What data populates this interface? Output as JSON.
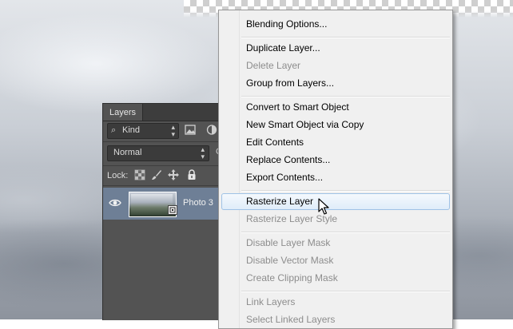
{
  "layers_panel": {
    "tab_label": "Layers",
    "filter": {
      "selected": "Kind",
      "icons": [
        "image-filter-icon",
        "adjustment-filter-icon"
      ]
    },
    "blend_mode": "Normal",
    "opacity_label_fragment": "O",
    "lock_label": "Lock:",
    "lock_icons": [
      "lock-transparent-pixels-icon",
      "lock-image-pixels-icon",
      "lock-position-icon",
      "lock-all-icon"
    ],
    "layers": [
      {
        "name": "Photo 3",
        "visible": true,
        "selected": true,
        "smart_object": true
      }
    ]
  },
  "context_menu": {
    "highlighted_item": "Rasterize Layer",
    "items": [
      {
        "label": "Blending Options...",
        "enabled": true
      },
      {
        "label": "Duplicate Layer...",
        "enabled": true
      },
      {
        "label": "Delete Layer",
        "enabled": false
      },
      {
        "label": "Group from Layers...",
        "enabled": true
      },
      {
        "label": "Convert to Smart Object",
        "enabled": true
      },
      {
        "label": "New Smart Object via Copy",
        "enabled": true
      },
      {
        "label": "Edit Contents",
        "enabled": true
      },
      {
        "label": "Replace Contents...",
        "enabled": true
      },
      {
        "label": "Export Contents...",
        "enabled": true
      },
      {
        "label": "Rasterize Layer",
        "enabled": true
      },
      {
        "label": "Rasterize Layer Style",
        "enabled": false
      },
      {
        "label": "Disable Layer Mask",
        "enabled": false
      },
      {
        "label": "Disable Vector Mask",
        "enabled": false
      },
      {
        "label": "Create Clipping Mask",
        "enabled": false
      },
      {
        "label": "Link Layers",
        "enabled": false
      },
      {
        "label": "Select Linked Layers",
        "enabled": false
      }
    ]
  },
  "colors": {
    "panel_bg": "#535353",
    "selected_layer": "#6e7f96",
    "menu_bg": "#f0f0f0",
    "menu_highlight_border": "#9fc2e6",
    "disabled_text": "#8d8d8d"
  }
}
